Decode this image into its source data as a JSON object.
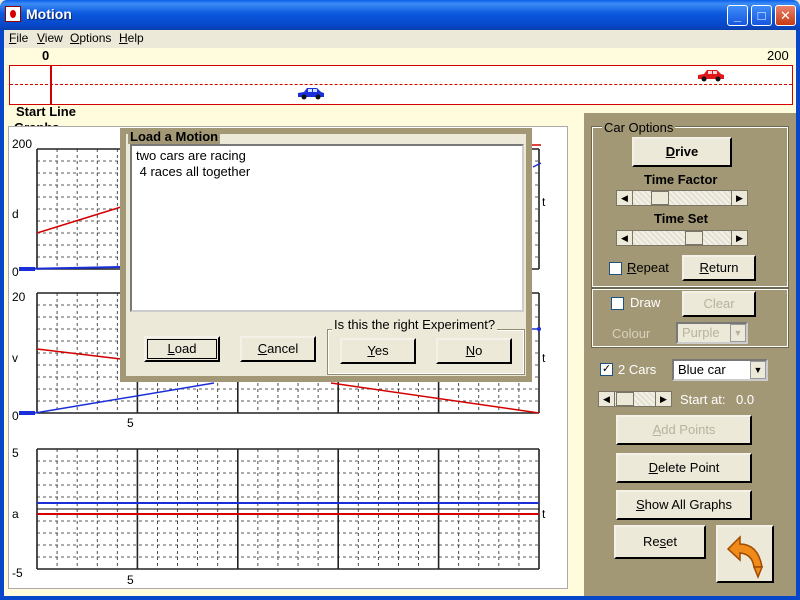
{
  "window": {
    "title": "Motion",
    "minimize": "_",
    "maximize": "□",
    "close": "✕"
  },
  "menu": [
    {
      "label": "File",
      "accel": "F",
      "rest": "ile"
    },
    {
      "label": "View",
      "accel": "V",
      "rest": "iew"
    },
    {
      "label": "Options",
      "accel": "O",
      "rest": "ptions"
    },
    {
      "label": "Help",
      "accel": "H",
      "rest": "elp"
    }
  ],
  "track": {
    "min_label": "0",
    "max_label": "200",
    "start_line_label": "Start Line",
    "cars": [
      {
        "name": "blue car",
        "color": "#1b2fd8"
      },
      {
        "name": "red car",
        "color": "#e01818"
      }
    ]
  },
  "graphs": {
    "section_label": "Graphs",
    "distance": {
      "ylabel": "d",
      "ymax": "200",
      "ymin": "0",
      "xlabel": "t"
    },
    "velocity": {
      "ylabel": "v",
      "ymax": "20",
      "ymin": "0",
      "xlabel": "t",
      "tick": "5"
    },
    "acceleration": {
      "ylabel": "a",
      "ymax": "5",
      "ymin": "-5",
      "xlabel": "t",
      "tick": "5"
    },
    "colors": {
      "blue": "#1b2fd8",
      "red": "#d40000"
    }
  },
  "dialog": {
    "title": "Load a Motion",
    "lines": [
      "two cars are racing",
      " 4 races all together"
    ],
    "load_button": {
      "accel": "L",
      "rest": "oad"
    },
    "cancel_button": {
      "accel": "C",
      "rest": "ancel"
    },
    "question": "Is this the right Experiment?",
    "yes_button": {
      "accel": "Y",
      "rest": "es"
    },
    "no_button": {
      "accel": "N",
      "rest": "o"
    }
  },
  "car_options": {
    "title": "Car Options",
    "drive_button": {
      "accel": "D",
      "rest": "rive"
    },
    "time_factor_label": "Time Factor",
    "time_set_label": "Time Set",
    "repeat": {
      "accel": "R",
      "rest": "epeat",
      "checked": false
    },
    "return_button": {
      "accel": "R",
      "rest": "eturn"
    },
    "draw": {
      "label": "Draw",
      "checked": false
    },
    "clear_button": "Clear",
    "colour_label": "Colour",
    "colour_value": "Purple",
    "two_cars": {
      "label": "2 Cars",
      "checked": true
    },
    "car_select": "Blue car",
    "start_at_label": "Start at:",
    "start_at_value": "0.0",
    "add_points_button": {
      "accel": "A",
      "rest": "dd Points"
    },
    "delete_point_button": {
      "accel": "D",
      "rest": "elete Point"
    },
    "show_all_graphs_button": {
      "accel": "S",
      "rest": "how All Graphs"
    },
    "reset_button": {
      "pre": "Re",
      "accel": "s",
      "rest": "et"
    },
    "check_mark": "✓",
    "arrow_left": "◀",
    "arrow_right": "▶",
    "arrow_down": "▼"
  }
}
